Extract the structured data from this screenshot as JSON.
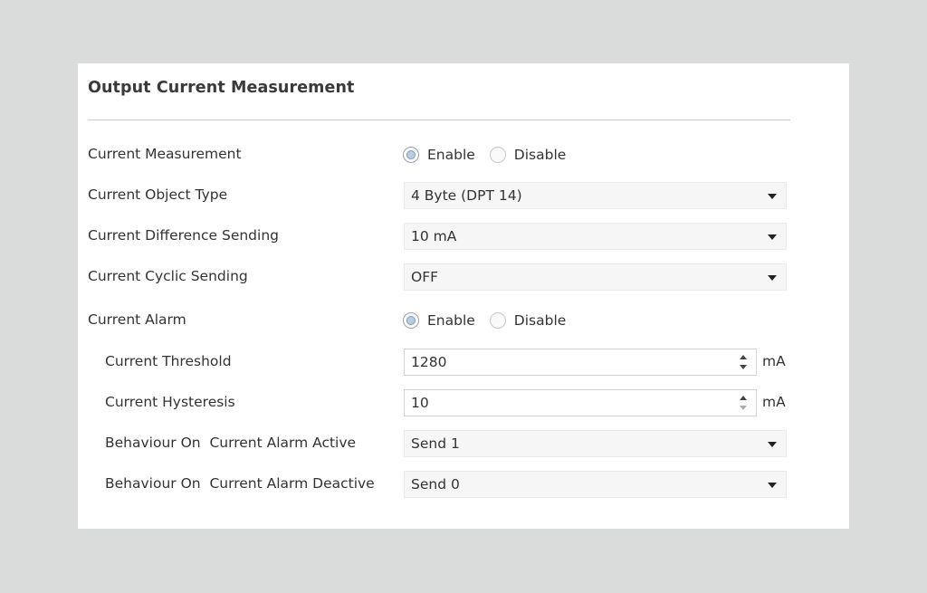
{
  "title": "Output Current Measurement",
  "rows": [
    {
      "label": "Current Measurement",
      "type": "radio",
      "options": [
        "Enable",
        "Disable"
      ],
      "selected": "Enable"
    },
    {
      "label": "Current Object Type",
      "type": "select",
      "value": "4 Byte (DPT 14)"
    },
    {
      "label": "Current Difference Sending",
      "type": "select",
      "value": "10 mA"
    },
    {
      "label": "Current Cyclic Sending",
      "type": "select",
      "value": "OFF"
    },
    {
      "label": "Current Alarm",
      "type": "radio",
      "options": [
        "Enable",
        "Disable"
      ],
      "selected": "Enable"
    },
    {
      "label": "Current Threshold",
      "type": "spin",
      "value": "1280",
      "unit": "mA"
    },
    {
      "label": "Current Hysteresis",
      "type": "spin",
      "value": "10",
      "unit": "mA"
    },
    {
      "label": "Behaviour On  Current Alarm Active",
      "type": "select",
      "value": "Send 1"
    },
    {
      "label": "Behaviour On  Current Alarm Deactive",
      "type": "select",
      "value": "Send 0"
    }
  ],
  "icons": {
    "dropdown": "chevron-down-icon",
    "spin_up": "spin-up-icon",
    "spin_down": "spin-down-icon"
  },
  "colors": {
    "background": "#d9dcdb",
    "panel": "#ffffff",
    "radio_selected": "#b9cde0"
  }
}
